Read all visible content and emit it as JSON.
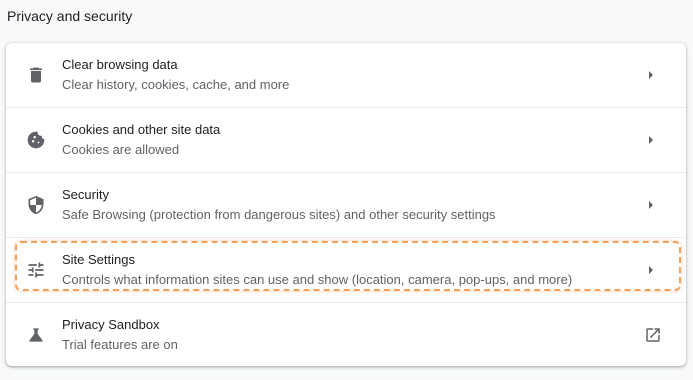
{
  "section": {
    "title": "Privacy and security"
  },
  "items": [
    {
      "label": "Clear browsing data",
      "sublabel": "Clear history, cookies, cache, and more",
      "icon": "trash-icon",
      "action": "chevron-right-icon"
    },
    {
      "label": "Cookies and other site data",
      "sublabel": "Cookies are allowed",
      "icon": "cookie-icon",
      "action": "chevron-right-icon"
    },
    {
      "label": "Security",
      "sublabel": "Safe Browsing (protection from dangerous sites) and other security settings",
      "icon": "shield-icon",
      "action": "chevron-right-icon"
    },
    {
      "label": "Site Settings",
      "sublabel": "Controls what information sites can use and show (location, camera, pop-ups, and more)",
      "icon": "tune-sliders-icon",
      "action": "chevron-right-icon",
      "highlighted": true
    },
    {
      "label": "Privacy Sandbox",
      "sublabel": "Trial features are on",
      "icon": "flask-icon",
      "action": "open-in-new-icon"
    }
  ],
  "colors": {
    "highlight": "#f5a05a",
    "icon": "#5f6368",
    "background": "#f8f9fa",
    "card": "#ffffff"
  }
}
